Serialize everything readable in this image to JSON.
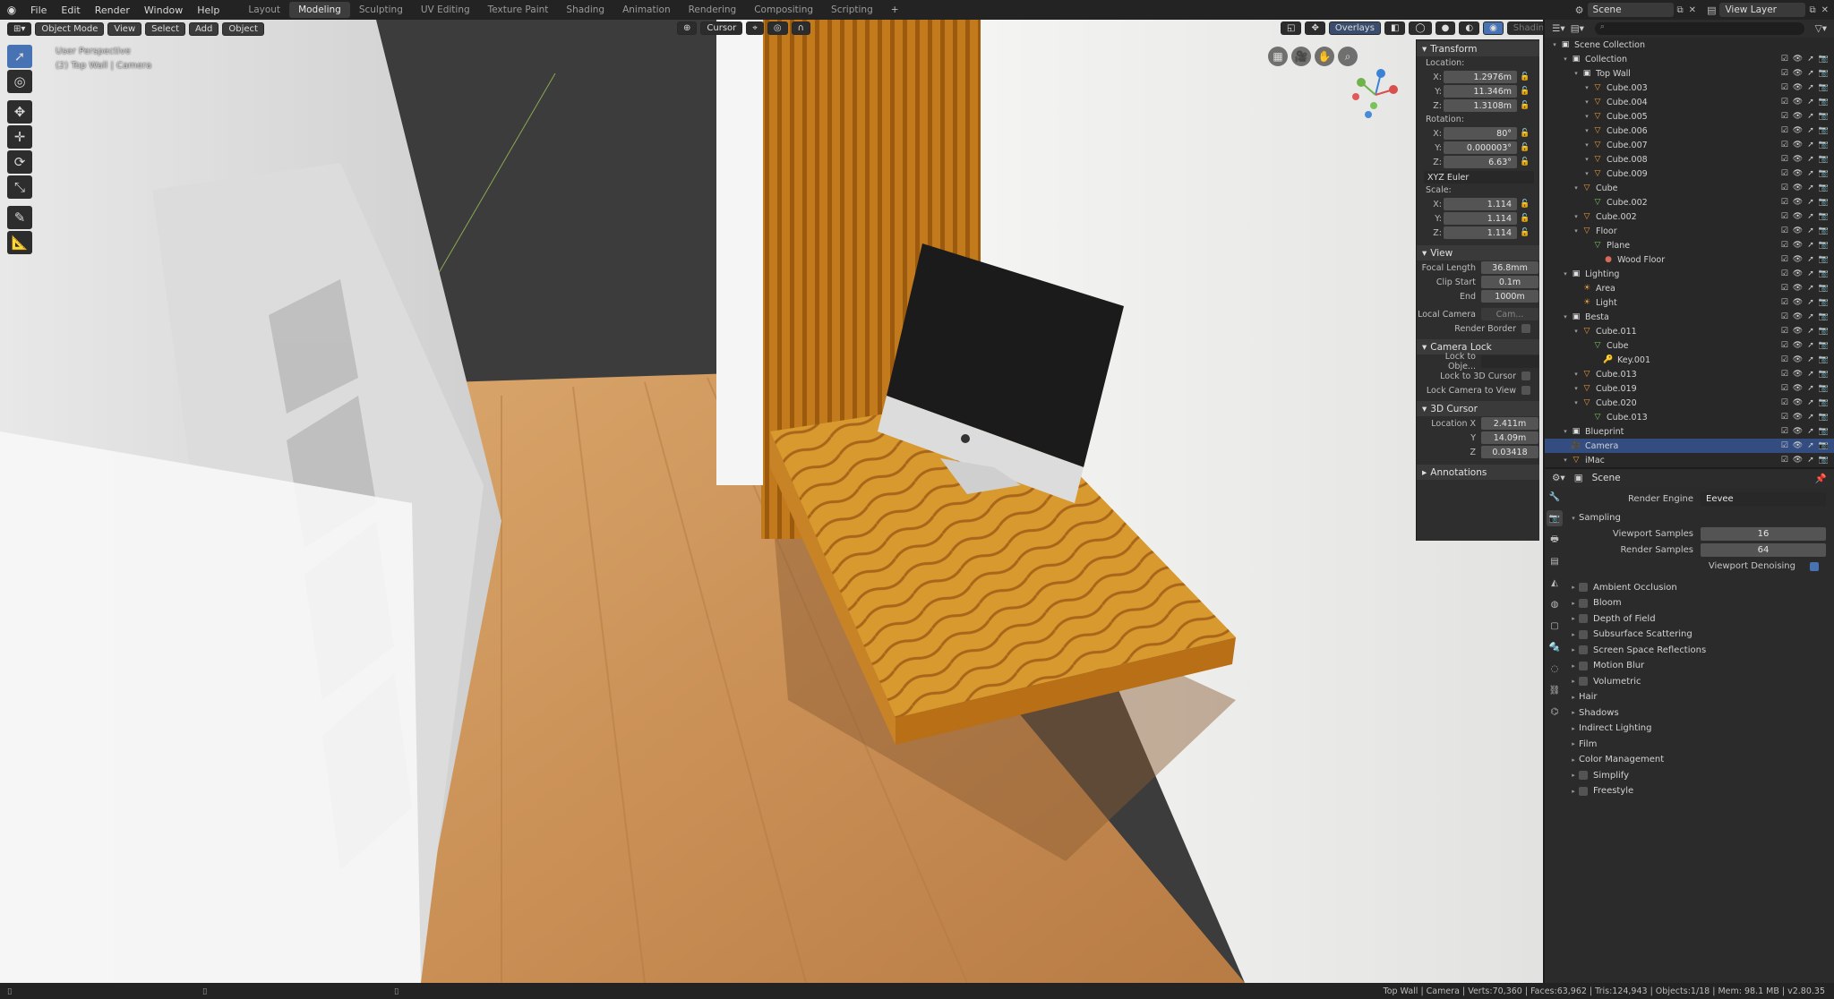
{
  "topbar": {
    "menus": [
      "File",
      "Edit",
      "Render",
      "Window",
      "Help"
    ],
    "workspaces": [
      "Layout",
      "Modeling",
      "Sculpting",
      "UV Editing",
      "Texture Paint",
      "Shading",
      "Animation",
      "Rendering",
      "Compositing",
      "Scripting"
    ],
    "active_workspace": "Modeling",
    "scene_name": "Scene",
    "view_layer": "View Layer"
  },
  "viewport": {
    "mode": "Object Mode",
    "menus": [
      "View",
      "Select",
      "Add",
      "Object"
    ],
    "transform_pivot": "Cursor",
    "overlays_label": "Overlays",
    "shading_label": "Shading",
    "info_line1": "User Perspective",
    "info_line2": "(2) Top Wall | Camera"
  },
  "npanel": {
    "transform_title": "Transform",
    "location_label": "Location:",
    "location": {
      "x": "1.2976m",
      "y": "11.346m",
      "z": "1.3108m"
    },
    "rotation_label": "Rotation:",
    "rotation": {
      "x": "80°",
      "y": "0.000003°",
      "z": "6.63°"
    },
    "rotation_mode": "XYZ Euler",
    "scale_label": "Scale:",
    "scale": {
      "x": "1.114",
      "y": "1.114",
      "z": "1.114"
    },
    "view_title": "View",
    "focal_length_label": "Focal Length",
    "focal_length": "36.8mm",
    "clip_start_label": "Clip Start",
    "clip_start": "0.1m",
    "clip_end_label": "End",
    "clip_end": "1000m",
    "local_camera_label": "Local Camera",
    "local_camera_value": "Cam...",
    "render_border_label": "Render Border",
    "camera_lock_title": "Camera Lock",
    "lock_to_object_label": "Lock to Obje...",
    "lock_to_cursor_label": "Lock to 3D Cursor",
    "lock_camera_to_view_label": "Lock Camera to View",
    "cursor_title": "3D Cursor",
    "cursor_location_label": "Location X",
    "cursor": {
      "x": "2.411m",
      "y": "14.09m",
      "z": "0.03418"
    },
    "annotations_title": "Annotations"
  },
  "outliner": {
    "items": [
      {
        "label": "Scene Collection",
        "indent": 0,
        "type": "collection"
      },
      {
        "label": "Collection",
        "indent": 1,
        "type": "collection"
      },
      {
        "label": "Top Wall",
        "indent": 2,
        "type": "collection"
      },
      {
        "label": "Cube.003",
        "indent": 3,
        "type": "mesh"
      },
      {
        "label": "Cube.004",
        "indent": 3,
        "type": "mesh"
      },
      {
        "label": "Cube.005",
        "indent": 3,
        "type": "mesh"
      },
      {
        "label": "Cube.006",
        "indent": 3,
        "type": "mesh"
      },
      {
        "label": "Cube.007",
        "indent": 3,
        "type": "mesh"
      },
      {
        "label": "Cube.008",
        "indent": 3,
        "type": "mesh"
      },
      {
        "label": "Cube.009",
        "indent": 3,
        "type": "mesh"
      },
      {
        "label": "Cube",
        "indent": 2,
        "type": "mesh"
      },
      {
        "label": "Cube.002",
        "indent": 3,
        "type": "data"
      },
      {
        "label": "Cube.002",
        "indent": 2,
        "type": "mesh"
      },
      {
        "label": "Floor",
        "indent": 2,
        "type": "mesh"
      },
      {
        "label": "Plane",
        "indent": 3,
        "type": "data"
      },
      {
        "label": "Wood Floor",
        "indent": 4,
        "type": "material"
      },
      {
        "label": "Lighting",
        "indent": 1,
        "type": "collection"
      },
      {
        "label": "Area",
        "indent": 2,
        "type": "light"
      },
      {
        "label": "Light",
        "indent": 2,
        "type": "light"
      },
      {
        "label": "Besta",
        "indent": 1,
        "type": "collection"
      },
      {
        "label": "Cube.011",
        "indent": 2,
        "type": "mesh"
      },
      {
        "label": "Cube",
        "indent": 3,
        "type": "data"
      },
      {
        "label": "Key.001",
        "indent": 4,
        "type": "key"
      },
      {
        "label": "Cube.013",
        "indent": 2,
        "type": "mesh"
      },
      {
        "label": "Cube.019",
        "indent": 2,
        "type": "mesh"
      },
      {
        "label": "Cube.020",
        "indent": 2,
        "type": "mesh"
      },
      {
        "label": "Cube.013",
        "indent": 3,
        "type": "data"
      },
      {
        "label": "Blueprint",
        "indent": 1,
        "type": "collection"
      },
      {
        "label": "Camera",
        "indent": 1,
        "type": "camera",
        "selected": true
      },
      {
        "label": "iMac",
        "indent": 1,
        "type": "mesh"
      }
    ]
  },
  "properties": {
    "context": "Scene",
    "render_engine_label": "Render Engine",
    "render_engine": "Eevee",
    "sampling_title": "Sampling",
    "viewport_samples_label": "Viewport Samples",
    "viewport_samples": "16",
    "render_samples_label": "Render Samples",
    "render_samples": "64",
    "viewport_denoising_label": "Viewport Denoising",
    "panels": [
      {
        "label": "Ambient Occlusion",
        "checkbox": true
      },
      {
        "label": "Bloom",
        "checkbox": true
      },
      {
        "label": "Depth of Field",
        "checkbox": true
      },
      {
        "label": "Subsurface Scattering",
        "checkbox": true
      },
      {
        "label": "Screen Space Reflections",
        "checkbox": true
      },
      {
        "label": "Motion Blur",
        "checkbox": true
      },
      {
        "label": "Volumetric",
        "checkbox": true
      },
      {
        "label": "Hair",
        "checkbox": false
      },
      {
        "label": "Shadows",
        "checkbox": false
      },
      {
        "label": "Indirect Lighting",
        "checkbox": false
      },
      {
        "label": "Film",
        "checkbox": false
      },
      {
        "label": "Color Management",
        "checkbox": false
      },
      {
        "label": "Simplify",
        "checkbox": true
      },
      {
        "label": "Freestyle",
        "checkbox": true
      }
    ]
  },
  "status": {
    "text": "Top Wall | Camera | Verts:70,360 | Faces:63,962 | Tris:124,943 | Objects:1/18 | Mem: 98.1 MB | v2.80.35"
  },
  "colors": {
    "accent": "#4772b3",
    "wood": "#c8892f",
    "wall": "#f0f0ee"
  }
}
